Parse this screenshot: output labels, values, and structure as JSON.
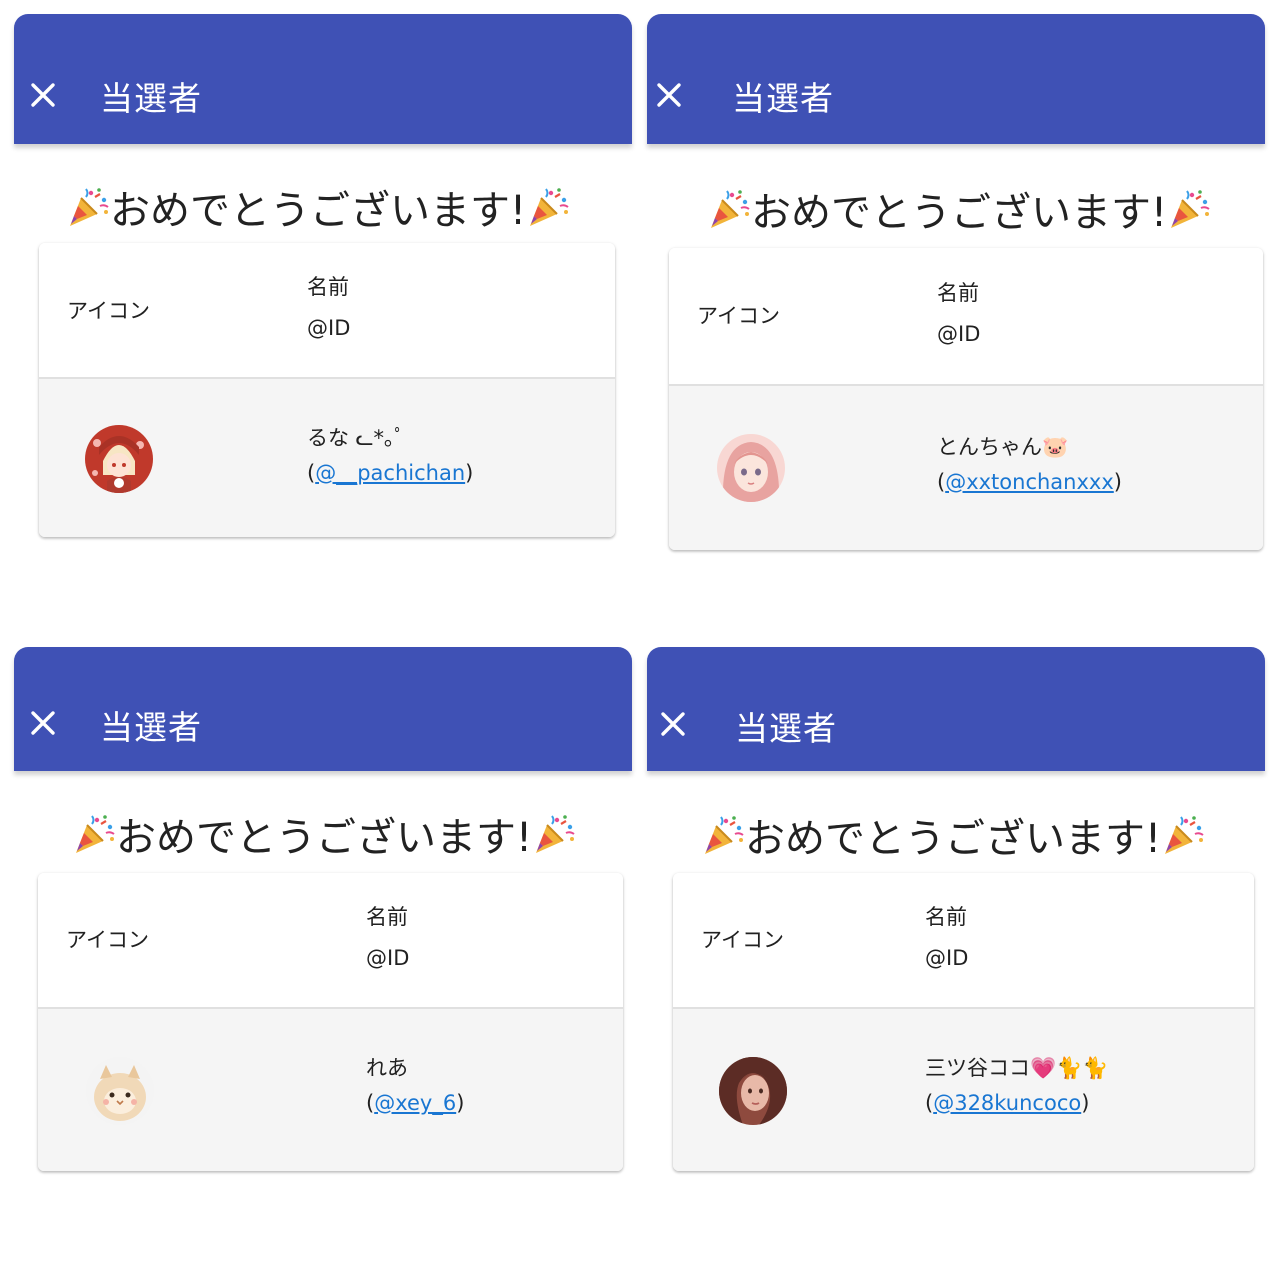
{
  "colors": {
    "appbar": "#3f51b5",
    "link": "#1976d2",
    "table_body": "#f5f5f5"
  },
  "panels": [
    {
      "title": "当選者",
      "congrats": "おめでとうございます!",
      "header_icon": "アイコン",
      "header_name": "名前",
      "header_id": "@ID",
      "winner_name": "るな ᓚ*｡ﾟ",
      "winner_handle": "@__pachichan"
    },
    {
      "title": "当選者",
      "congrats": "おめでとうございます!",
      "header_icon": "アイコン",
      "header_name": "名前",
      "header_id": "@ID",
      "winner_name": "とんちゃん🐷",
      "winner_handle": "@xxtonchanxxx"
    },
    {
      "title": "当選者",
      "congrats": "おめでとうございます!",
      "header_icon": "アイコン",
      "header_name": "名前",
      "header_id": "@ID",
      "winner_name": "れあ",
      "winner_handle": "@xey_6"
    },
    {
      "title": "当選者",
      "congrats": "おめでとうございます!",
      "header_icon": "アイコン",
      "header_name": "名前",
      "header_id": "@ID",
      "winner_name": "三ツ谷ココ💗🐈🐈",
      "winner_handle": "@328kuncoco"
    }
  ],
  "icons": {
    "close": "close-icon",
    "party_popper": "party-popper-icon",
    "avatar": "avatar-image"
  }
}
